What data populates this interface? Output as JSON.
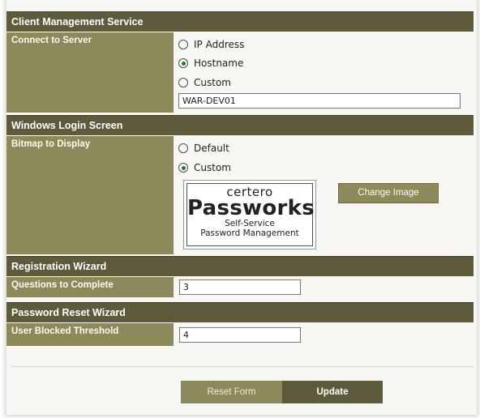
{
  "sections": {
    "client_management": {
      "title": "Client Management Service",
      "connect_label": "Connect to Server",
      "options": [
        "IP Address",
        "Hostname",
        "Custom"
      ],
      "selected": "Hostname",
      "server_value": "WAR-DEV01"
    },
    "windows_login": {
      "title": "Windows Login Screen",
      "bitmap_label": "Bitmap to Display",
      "options": [
        "Default",
        "Custom"
      ],
      "selected": "Custom",
      "logo": {
        "line1": "certero",
        "line2": "Passworks",
        "line3": "Self-Service",
        "line4": "Password Management"
      },
      "change_image_label": "Change Image"
    },
    "registration_wizard": {
      "title": "Registration Wizard",
      "questions_label": "Questions to Complete",
      "questions_value": "3"
    },
    "password_reset_wizard": {
      "title": "Password Reset Wizard",
      "blocked_label": "User Blocked Threshold",
      "blocked_value": "4"
    }
  },
  "buttons": {
    "reset": "Reset Form",
    "update": "Update"
  },
  "colors": {
    "header_bg": "#5e5a3c",
    "label_bg": "#8c8a5a",
    "panel_bg": "#f6f6f2"
  }
}
